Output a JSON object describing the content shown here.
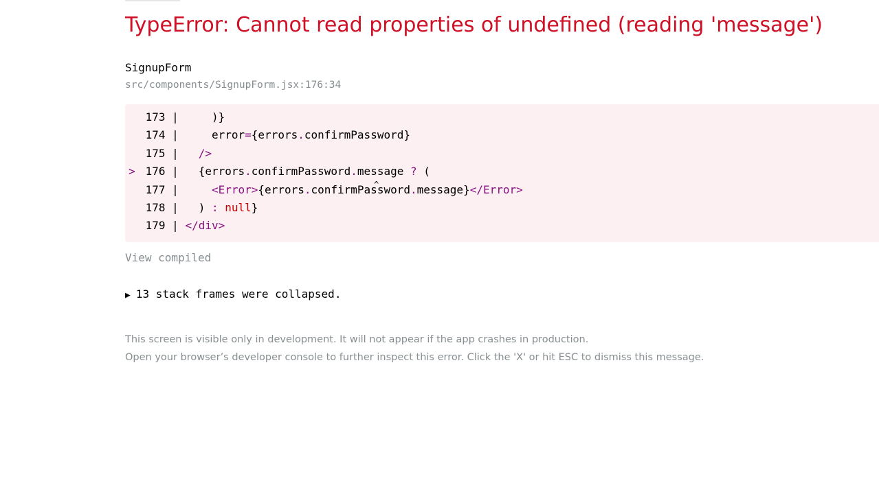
{
  "error": {
    "title": "TypeError: Cannot read properties of undefined (reading 'message')",
    "component": "SignupForm",
    "location": "src/components/SignupForm.jsx:176:34"
  },
  "code": {
    "lines": [
      {
        "number": "173",
        "highlighted": false,
        "tokens": [
          {
            "t": "plain",
            "v": "    )}"
          }
        ]
      },
      {
        "number": "174",
        "highlighted": false,
        "tokens": [
          {
            "t": "plain",
            "v": "    error"
          },
          {
            "t": "op",
            "v": "="
          },
          {
            "t": "plain",
            "v": "{errors"
          },
          {
            "t": "op",
            "v": "."
          },
          {
            "t": "plain",
            "v": "confirmPassword}"
          }
        ]
      },
      {
        "number": "175",
        "highlighted": false,
        "tokens": [
          {
            "t": "plain",
            "v": "  "
          },
          {
            "t": "tag",
            "v": "/>"
          }
        ]
      },
      {
        "number": "176",
        "highlighted": true,
        "tokens": [
          {
            "t": "plain",
            "v": "  {errors"
          },
          {
            "t": "op",
            "v": "."
          },
          {
            "t": "plain",
            "v": "confirmPassword"
          },
          {
            "t": "op",
            "v": "."
          },
          {
            "t": "plain",
            "v": "message "
          },
          {
            "t": "op",
            "v": "?"
          },
          {
            "t": "plain",
            "v": " ("
          }
        ]
      },
      {
        "number": "177",
        "highlighted": false,
        "tokens": [
          {
            "t": "plain",
            "v": "    "
          },
          {
            "t": "tag",
            "v": "<Error>"
          },
          {
            "t": "plain",
            "v": "{errors"
          },
          {
            "t": "op",
            "v": "."
          },
          {
            "t": "plain",
            "v": "confirmPassword"
          },
          {
            "t": "op",
            "v": "."
          },
          {
            "t": "plain",
            "v": "message}"
          },
          {
            "t": "tag",
            "v": "</Error>"
          }
        ]
      },
      {
        "number": "178",
        "highlighted": false,
        "tokens": [
          {
            "t": "plain",
            "v": "  ) "
          },
          {
            "t": "op",
            "v": ":"
          },
          {
            "t": "plain",
            "v": " "
          },
          {
            "t": "kw",
            "v": "null"
          },
          {
            "t": "plain",
            "v": "}"
          }
        ]
      },
      {
        "number": "179",
        "highlighted": false,
        "tokens": [
          {
            "t": "tag",
            "v": "</div>"
          }
        ]
      }
    ],
    "marker": ">",
    "caret": "^"
  },
  "actions": {
    "view_compiled": "View compiled",
    "stack_toggle_icon": "triangle-right-icon",
    "stack_triangle": "▶",
    "stack_frames_label": "13 stack frames were collapsed."
  },
  "footer": {
    "line1": "This screen is visible only in development. It will not appear if the app crashes in production.",
    "line2": "Open your browser’s developer console to further inspect this error.  Click the 'X' or hit ESC to dismiss this message."
  },
  "colors": {
    "error_red": "#ce1126",
    "code_bg": "#fcf0f2",
    "muted_gray": "#878e91",
    "tag_purple": "#881280",
    "keyword_red": "#c80000"
  }
}
